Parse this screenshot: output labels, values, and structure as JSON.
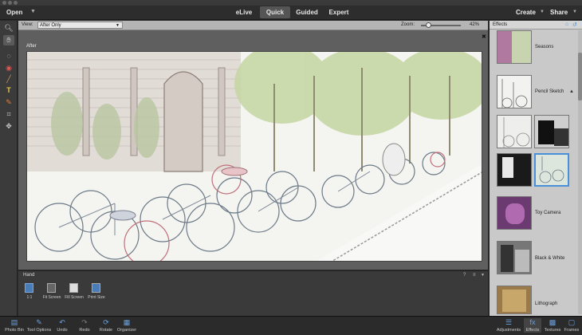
{
  "menubar": {
    "open_label": "Open",
    "tabs": [
      {
        "label": "eLive"
      },
      {
        "label": "Quick"
      },
      {
        "label": "Guided"
      },
      {
        "label": "Expert"
      }
    ],
    "create_label": "Create",
    "share_label": "Share"
  },
  "options": {
    "view_label": "View:",
    "view_value": "After Only",
    "zoom_label": "Zoom:",
    "zoom_value": "42%",
    "zoom_level": 0.42
  },
  "canvas": {
    "after_label": "After"
  },
  "bottom": {
    "tool_name": "Hand",
    "buttons": [
      {
        "label": "1:1",
        "icon": "actual-pixels-icon"
      },
      {
        "label": "Fit Screen",
        "icon": "fit-screen-icon"
      },
      {
        "label": "Fill Screen",
        "icon": "fill-screen-icon"
      },
      {
        "label": "Print Size",
        "icon": "print-size-icon"
      }
    ]
  },
  "effects": {
    "title": "Effects",
    "items": [
      {
        "label": "Seasons"
      },
      {
        "label": "Pencil Sketch"
      },
      {
        "label": "Toy Camera"
      },
      {
        "label": "Black & White"
      },
      {
        "label": "Lithograph"
      }
    ]
  },
  "statusbar": {
    "left": [
      {
        "label": "Photo Bin",
        "icon": "photo-bin-icon"
      },
      {
        "label": "Tool Options",
        "icon": "tool-options-icon"
      },
      {
        "label": "Undo",
        "icon": "undo-icon"
      },
      {
        "label": "Redo",
        "icon": "redo-icon"
      },
      {
        "label": "Rotate",
        "icon": "rotate-icon"
      },
      {
        "label": "Organizer",
        "icon": "organizer-icon"
      }
    ],
    "right": [
      {
        "label": "Adjustments",
        "icon": "adjustments-icon"
      },
      {
        "label": "Effects",
        "icon": "effects-icon"
      },
      {
        "label": "Textures",
        "icon": "textures-icon"
      },
      {
        "label": "Frames",
        "icon": "frames-icon"
      }
    ]
  },
  "colors": {
    "accent": "#4a90d9",
    "panel": "#c9c9c9",
    "dark": "#2b2b2b"
  }
}
